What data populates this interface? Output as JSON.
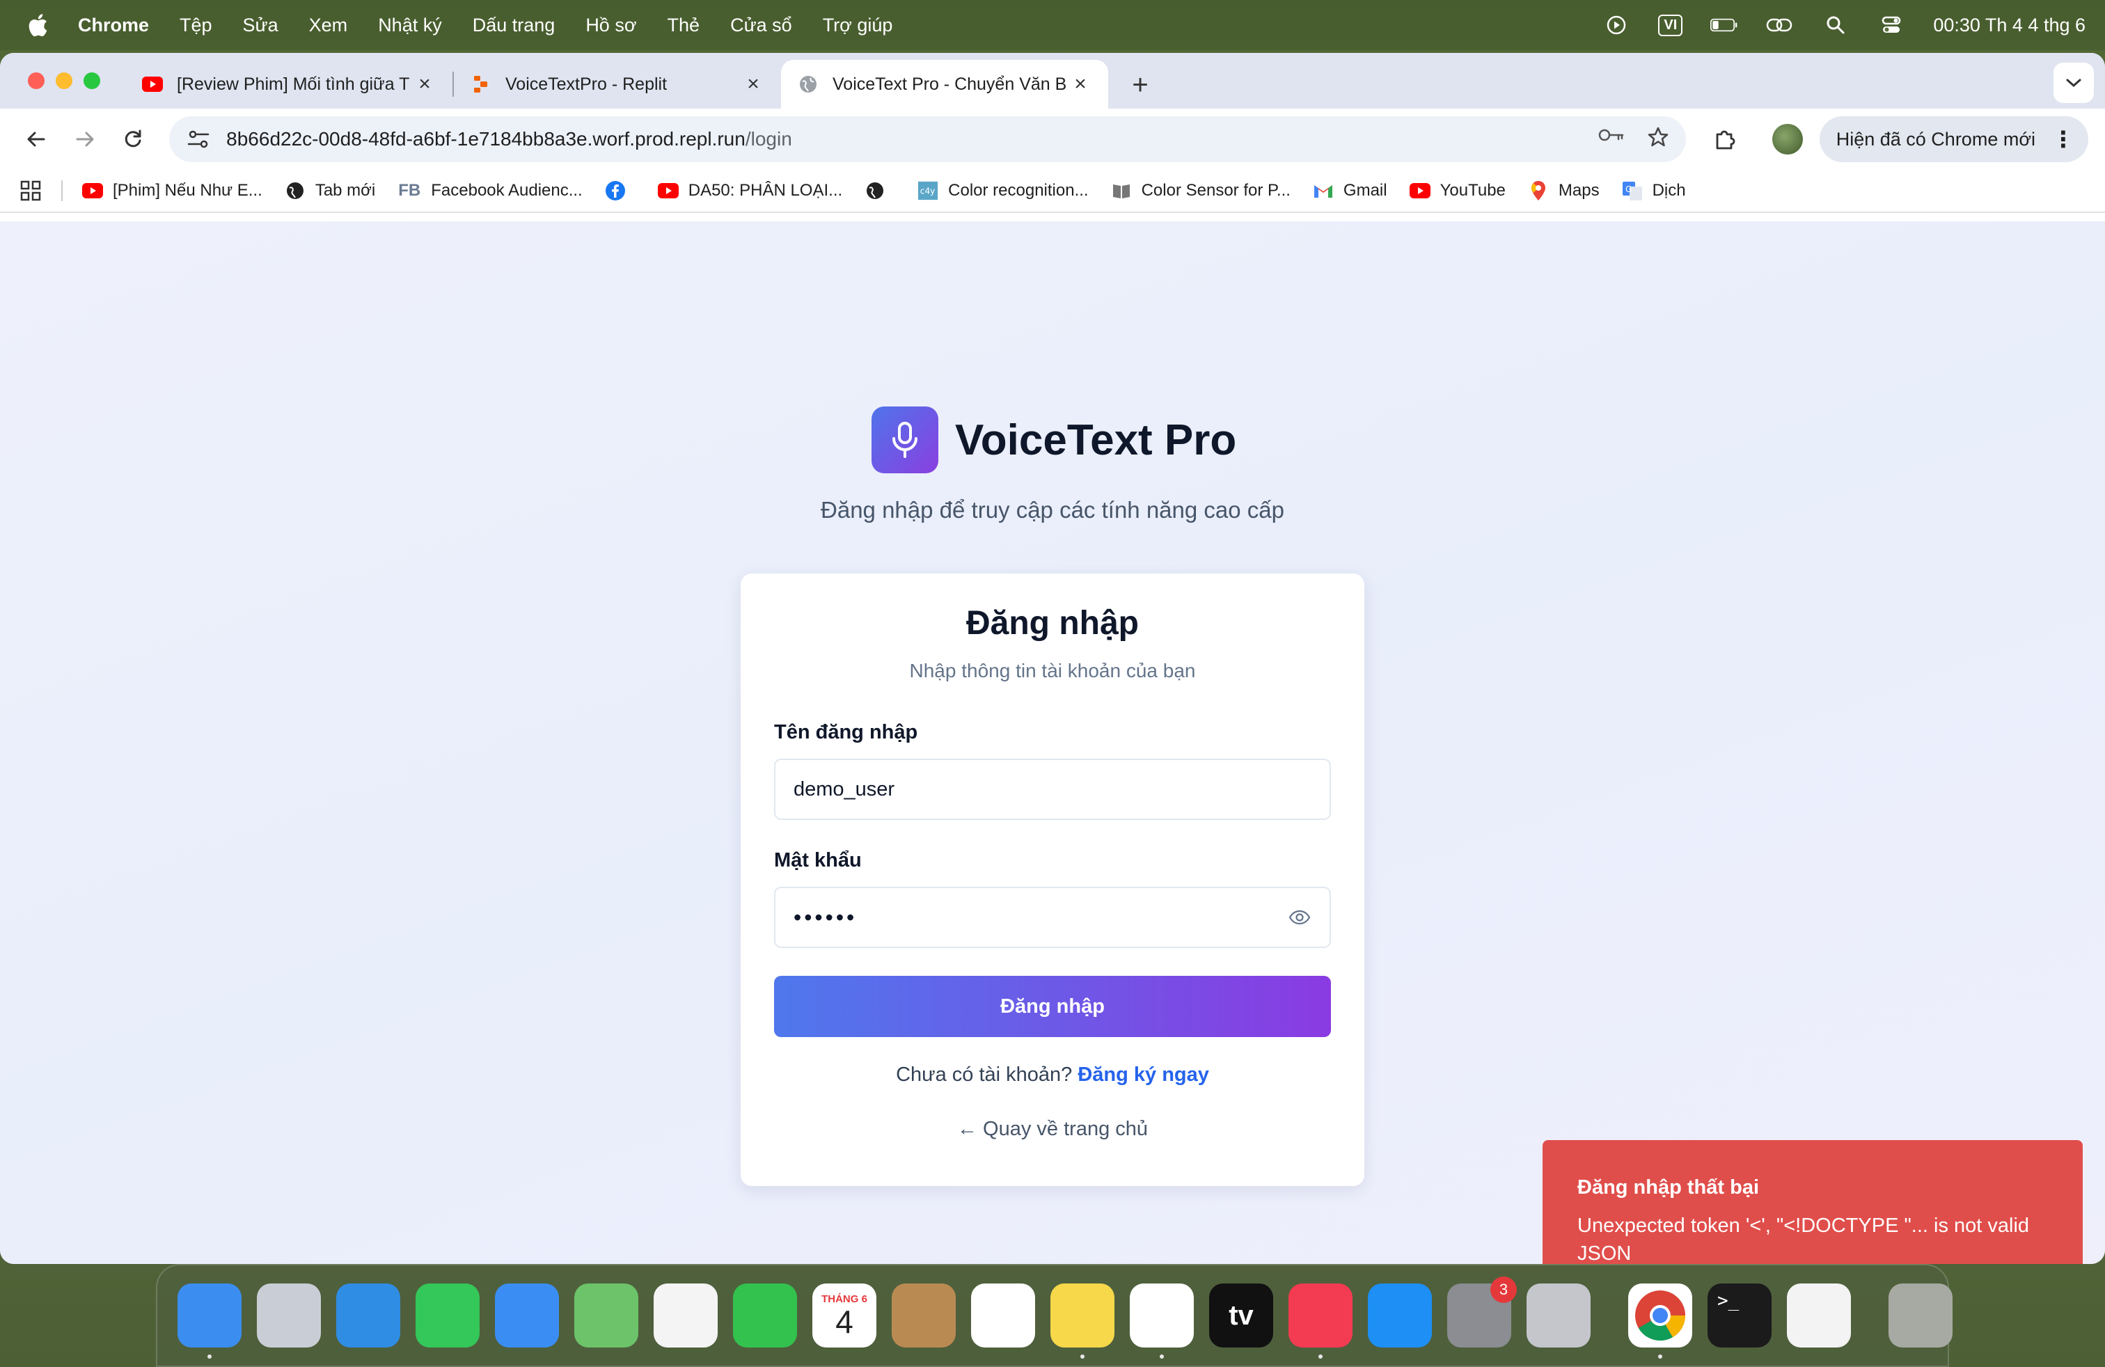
{
  "menubar": {
    "app_name": "Chrome",
    "items": [
      "Tệp",
      "Sửa",
      "Xem",
      "Nhật ký",
      "Dấu trang",
      "Hồ sơ",
      "Thẻ",
      "Cửa sổ",
      "Trợ giúp"
    ],
    "input_method": "VI",
    "clock": "00:30 Th 4 4 thg 6"
  },
  "tabs": [
    {
      "title": "[Review Phim] Mối tình giữa T",
      "icon": "youtube-icon",
      "active": false
    },
    {
      "title": "VoiceTextPro - Replit",
      "icon": "replit-icon",
      "active": false
    },
    {
      "title": "VoiceText Pro - Chuyển Văn B",
      "icon": "globe-icon",
      "active": true
    }
  ],
  "omnibox": {
    "url_host": "8b66d22c-00d8-48fd-a6bf-1e7184bb8a3e.worf.prod.repl.run",
    "url_path": "/login"
  },
  "toolbar": {
    "update_label": "Hiện đã có Chrome mới"
  },
  "bookmarks": [
    {
      "label": "[Phim] Nếu Như E...",
      "icon": "youtube-icon"
    },
    {
      "label": "Tab mới",
      "icon": "globe-icon"
    },
    {
      "label": "Facebook Audienc...",
      "icon": "fb-text-icon"
    },
    {
      "label": "",
      "icon": "facebook-icon"
    },
    {
      "label": "DA50: PHÂN LOẠI...",
      "icon": "youtube-icon"
    },
    {
      "label": "",
      "icon": "globe-icon"
    },
    {
      "label": "Color recognition...",
      "icon": "c4y-icon"
    },
    {
      "label": "Color Sensor for P...",
      "icon": "book-icon"
    },
    {
      "label": "Gmail",
      "icon": "gmail-icon"
    },
    {
      "label": "YouTube",
      "icon": "youtube-icon"
    },
    {
      "label": "Maps",
      "icon": "maps-icon"
    },
    {
      "label": "Dịch",
      "icon": "translate-icon"
    }
  ],
  "page": {
    "brand_name": "VoiceText Pro",
    "tagline": "Đăng nhập để truy cập các tính năng cao cấp",
    "card": {
      "title": "Đăng nhập",
      "subtitle": "Nhập thông tin tài khoản của bạn",
      "username_label": "Tên đăng nhập",
      "username_value": "demo_user",
      "password_label": "Mật khẩu",
      "password_masked": "••••••",
      "submit_label": "Đăng nhập",
      "no_account_text": "Chưa có tài khoản?",
      "register_link": "Đăng ký ngay",
      "back_link": "← Quay về trang chủ"
    }
  },
  "toast": {
    "title": "Đăng nhập thất bại",
    "message": "Unexpected token '<', \"<!DOCTYPE \"... is not valid JSON"
  },
  "dock": {
    "apps": [
      {
        "name": "finder",
        "color": "#3b8ef0",
        "running": true
      },
      {
        "name": "launchpad",
        "color": "#c9ced6",
        "running": false
      },
      {
        "name": "safari",
        "color": "#2f8de4",
        "running": false
      },
      {
        "name": "messages",
        "color": "#34c759",
        "running": false
      },
      {
        "name": "mail",
        "color": "#3a8ef3",
        "running": false
      },
      {
        "name": "maps",
        "color": "#6cc36a",
        "running": false
      },
      {
        "name": "photos",
        "color": "#f4f4f4",
        "running": false
      },
      {
        "name": "facetime",
        "color": "#33c24d",
        "running": false
      },
      {
        "name": "calendar",
        "color": "#ffffff",
        "running": false,
        "month": "THÁNG 6",
        "day": "4"
      },
      {
        "name": "contacts",
        "color": "#b98b52",
        "running": false
      },
      {
        "name": "reminders",
        "color": "#ffffff",
        "running": false
      },
      {
        "name": "notes",
        "color": "#f7d84a",
        "running": true
      },
      {
        "name": "freeform",
        "color": "#ffffff",
        "running": true
      },
      {
        "name": "apple-tv",
        "color": "#111111",
        "running": false,
        "label": "tv"
      },
      {
        "name": "music",
        "color": "#f33b51",
        "running": true
      },
      {
        "name": "app-store",
        "color": "#1d8ff5",
        "running": false
      },
      {
        "name": "system-settings",
        "color": "#8b8d92",
        "running": false,
        "badge": "3"
      },
      {
        "name": "iphone-mirroring",
        "color": "#c4c6cc",
        "running": false
      }
    ],
    "recent": [
      {
        "name": "chrome",
        "color": "#ffffff",
        "running": true
      },
      {
        "name": "terminal",
        "color": "#1b1b1b",
        "running": false
      },
      {
        "name": "textedit",
        "color": "#f3f3f3",
        "running": false
      }
    ],
    "trash": {
      "name": "trash",
      "color": "#a7aaa3"
    }
  }
}
